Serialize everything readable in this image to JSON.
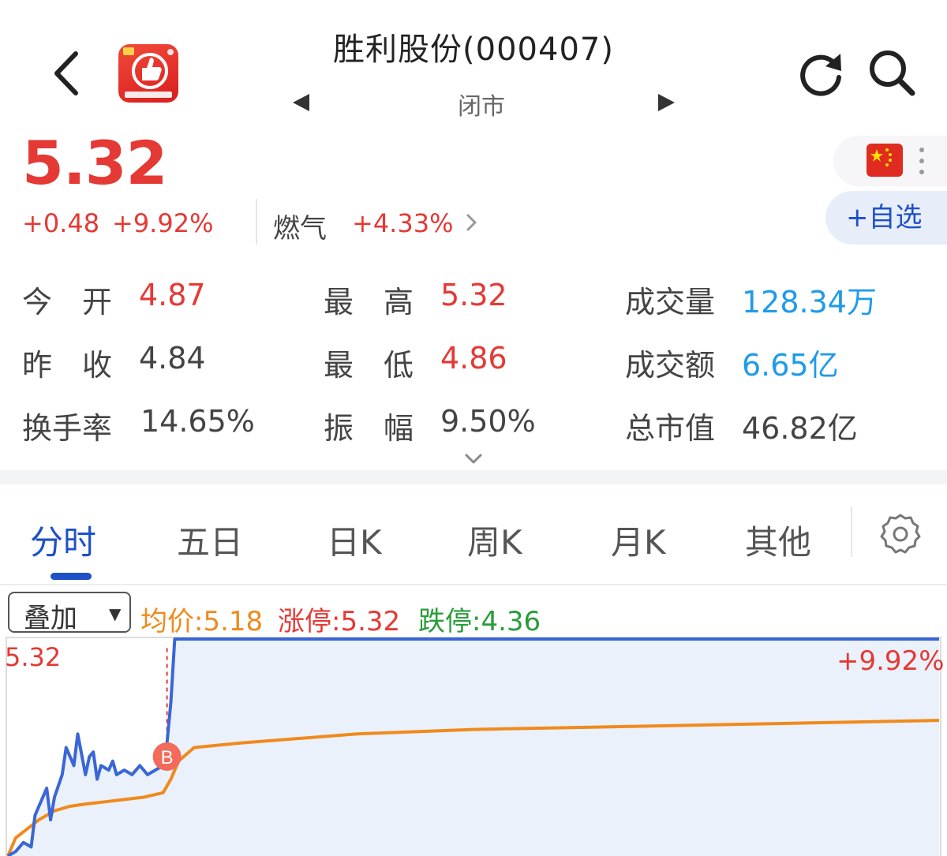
{
  "header": {
    "title": "胜利股份(000407)",
    "status": "闭市"
  },
  "quote": {
    "price": "5.32",
    "change": "+0.48",
    "change_pct": "+9.92%",
    "sector": "燃气",
    "sector_change": "+4.33%",
    "watchlist_label": "+自选"
  },
  "stats": {
    "open_label": "今　开",
    "open_value": "4.87",
    "prev_close_label": "昨　收",
    "prev_close_value": "4.84",
    "turnover_rate_label": "换手率",
    "turnover_rate_value": "14.65%",
    "high_label": "最　高",
    "high_value": "5.32",
    "low_label": "最　低",
    "low_value": "4.86",
    "amplitude_label": "振　幅",
    "amplitude_value": "9.50%",
    "volume_label": "成交量",
    "volume_value": "128.34万",
    "amount_label": "成交额",
    "amount_value": "6.65亿",
    "market_cap_label": "总市值",
    "market_cap_value": "46.82亿"
  },
  "tabs": [
    "分时",
    "五日",
    "日K",
    "周K",
    "月K",
    "其他"
  ],
  "chart_header": {
    "overlay_label": "叠加",
    "avg_price": "均价:5.18",
    "limit_up": "涨停:5.32",
    "limit_down": "跌停:4.36"
  },
  "chart_data": {
    "type": "line",
    "high_label": "5.32",
    "pct_label": "+9.92%",
    "marker_label": "B",
    "ylim": [
      4.84,
      5.32
    ],
    "series": [
      {
        "color": "#3a66d6",
        "x": [
          0,
          2,
          4,
          6,
          7,
          8,
          10,
          11,
          12,
          14,
          15,
          17,
          18,
          20,
          21,
          22,
          23,
          24,
          26,
          27,
          28,
          30,
          32,
          34,
          36,
          38,
          40,
          41,
          42,
          43,
          44,
          46,
          240
        ],
        "values": [
          4.84,
          4.85,
          4.87,
          4.86,
          4.93,
          4.95,
          4.99,
          4.92,
          4.97,
          5.02,
          5.08,
          5.04,
          5.11,
          5.02,
          5.06,
          5.07,
          5.01,
          5.04,
          5.03,
          5.05,
          5.02,
          5.03,
          5.02,
          5.04,
          5.02,
          5.03,
          5.04,
          5.09,
          5.18,
          5.32,
          5.32,
          5.32,
          5.32
        ]
      },
      {
        "color": "#f08a1c",
        "x": [
          0,
          2,
          5,
          8,
          12,
          16,
          20,
          25,
          30,
          35,
          40,
          42,
          44,
          48,
          60,
          90,
          120,
          180,
          240
        ],
        "values": [
          4.84,
          4.88,
          4.9,
          4.92,
          4.94,
          4.95,
          4.955,
          4.96,
          4.965,
          4.97,
          4.98,
          5.01,
          5.05,
          5.08,
          5.09,
          5.11,
          5.12,
          5.13,
          5.14
        ]
      }
    ]
  }
}
